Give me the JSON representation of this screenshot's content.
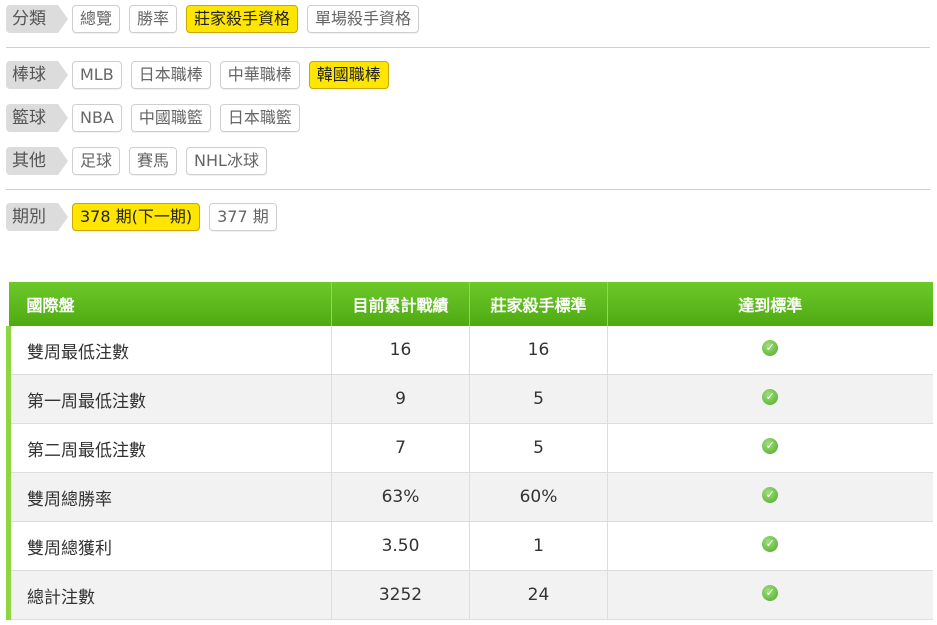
{
  "filters": {
    "classification": {
      "label": "分類",
      "options": [
        "總覽",
        "勝率",
        "莊家殺手資格",
        "單場殺手資格"
      ],
      "active": "莊家殺手資格"
    },
    "baseball": {
      "label": "棒球",
      "options": [
        "MLB",
        "日本職棒",
        "中華職棒",
        "韓國職棒"
      ],
      "active": "韓國職棒"
    },
    "basketball": {
      "label": "籃球",
      "options": [
        "NBA",
        "中國職籃",
        "日本職籃"
      ]
    },
    "other": {
      "label": "其他",
      "options": [
        "足球",
        "賽馬",
        "NHL冰球"
      ]
    },
    "period": {
      "label": "期別",
      "options": [
        "378 期(下一期)",
        "377 期"
      ],
      "active": "378 期(下一期)"
    }
  },
  "table": {
    "headers": [
      "國際盤",
      "目前累計戰績",
      "莊家殺手標準",
      "達到標準"
    ],
    "rows": [
      {
        "name": "雙周最低注數",
        "current": "16",
        "standard": "16",
        "met": true
      },
      {
        "name": "第一周最低注數",
        "current": "9",
        "standard": "5",
        "met": true
      },
      {
        "name": "第二周最低注數",
        "current": "7",
        "standard": "5",
        "met": true
      },
      {
        "name": "雙周總勝率",
        "current": "63%",
        "standard": "60%",
        "met": true
      },
      {
        "name": "雙周總獲利",
        "current": "3.50",
        "standard": "1",
        "met": true
      },
      {
        "name": "總計注數",
        "current": "3252",
        "standard": "24",
        "met": true
      }
    ]
  },
  "colors": {
    "active_chip": "#ffe600",
    "header_green": "#5cb81c",
    "row_accent": "#8ed63f",
    "check_icon": "#6cc04a"
  }
}
